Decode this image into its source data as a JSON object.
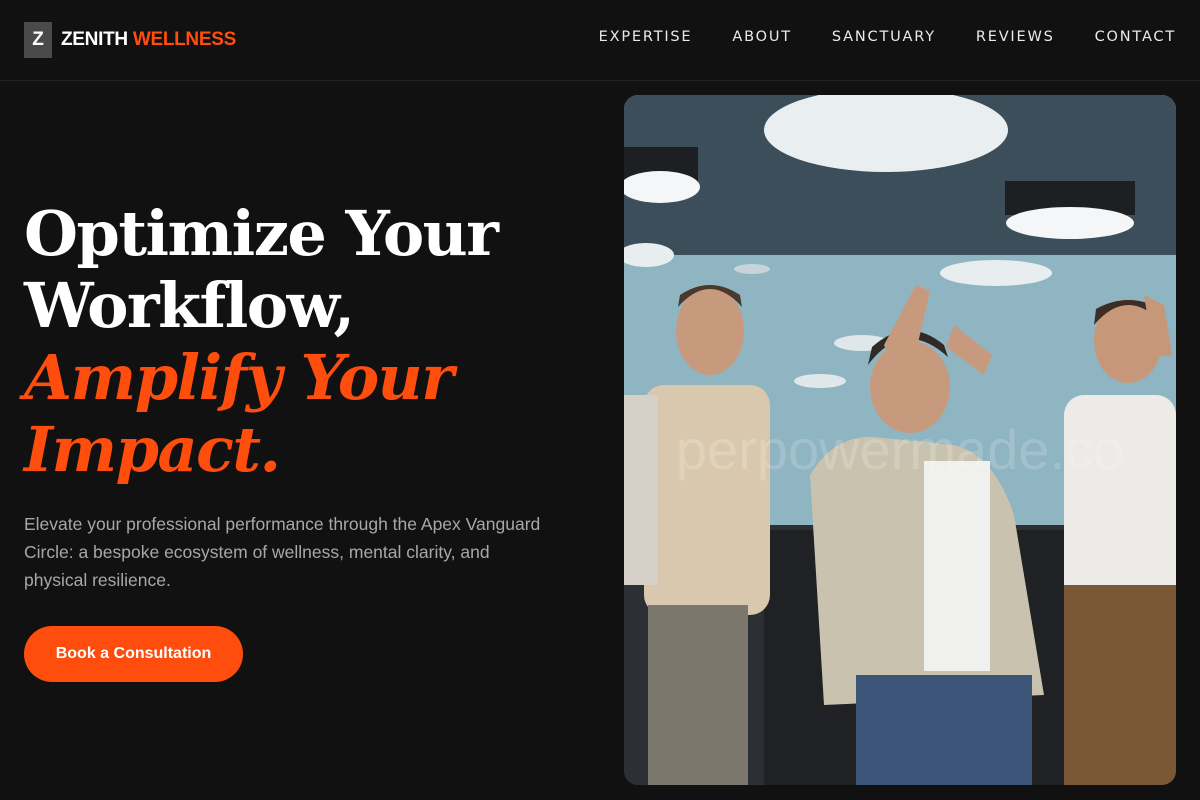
{
  "brand": {
    "mark": "Z",
    "name_primary": "ZENITH",
    "name_accent": "WELLNESS",
    "accent_color": "#ff4d0e"
  },
  "nav": {
    "items": [
      {
        "label": "EXPERTISE"
      },
      {
        "label": "ABOUT"
      },
      {
        "label": "SANCTUARY"
      },
      {
        "label": "REVIEWS"
      },
      {
        "label": "CONTACT"
      }
    ]
  },
  "hero": {
    "title_line1": "Optimize Your",
    "title_line2": "Workflow,",
    "title_accent_line1": "Amplify Your",
    "title_accent_line2": "Impact.",
    "subtitle": "Elevate your professional performance through the Apex Vanguard Circle: a bespoke ecosystem of wellness, mental clarity, and physical resilience.",
    "cta_label": "Book a Consultation"
  },
  "image": {
    "watermark": "perpowermade.co"
  }
}
